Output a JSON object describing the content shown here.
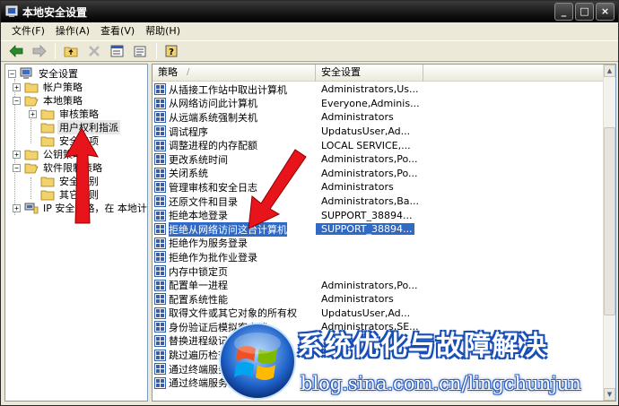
{
  "window": {
    "title": "本地安全设置",
    "buttons": [
      "_",
      "□",
      "×"
    ]
  },
  "menu": [
    "文件(F)",
    "操作(A)",
    "查看(V)",
    "帮助(H)"
  ],
  "toolbar": {
    "icons": [
      "back-icon",
      "forward-icon",
      "up-folder-icon",
      "delete-icon",
      "properties-icon",
      "export-list-icon",
      "help-icon"
    ]
  },
  "tree": [
    {
      "label": "安全设置",
      "level": 0,
      "expander": "−",
      "icon": "security-settings-icon"
    },
    {
      "label": "帐户策略",
      "level": 1,
      "expander": "+",
      "icon": "folder-icon"
    },
    {
      "label": "本地策略",
      "level": 1,
      "expander": "−",
      "icon": "folder-open-icon"
    },
    {
      "label": "审核策略",
      "level": 2,
      "expander": "+",
      "icon": "folder-icon"
    },
    {
      "label": "用户权利指派",
      "level": 2,
      "expander": "",
      "icon": "folder-icon",
      "selected": true
    },
    {
      "label": "安全选项",
      "level": 2,
      "expander": "",
      "icon": "folder-icon"
    },
    {
      "label": "公钥策略",
      "level": 1,
      "expander": "+",
      "icon": "folder-icon"
    },
    {
      "label": "软件限制策略",
      "level": 1,
      "expander": "−",
      "icon": "folder-open-icon"
    },
    {
      "label": "安全级别",
      "level": 2,
      "expander": "",
      "icon": "folder-icon"
    },
    {
      "label": "其它规则",
      "level": 2,
      "expander": "",
      "icon": "folder-icon"
    },
    {
      "label": "IP 安全策略，在 本地计",
      "level": 1,
      "expander": "+",
      "icon": "ip-security-icon"
    }
  ],
  "list": {
    "columns": [
      "策略",
      "安全设置"
    ],
    "sort_glyph": "/",
    "rows": [
      {
        "name": "从插接工作站中取出计算机",
        "setting": "Administrators,Us..."
      },
      {
        "name": "从网络访问此计算机",
        "setting": "Everyone,Adminis..."
      },
      {
        "name": "从远端系统强制关机",
        "setting": "Administrators"
      },
      {
        "name": "调试程序",
        "setting": "UpdatusUser,Ad..."
      },
      {
        "name": "调整进程的内存配额",
        "setting": "LOCAL SERVICE,..."
      },
      {
        "name": "更改系统时间",
        "setting": "Administrators,Po..."
      },
      {
        "name": "关闭系统",
        "setting": "Administrators,Po..."
      },
      {
        "name": "管理审核和安全日志",
        "setting": "Administrators"
      },
      {
        "name": "还原文件和目录",
        "setting": "Administrators,Ba..."
      },
      {
        "name": "拒绝本地登录",
        "setting": "SUPPORT_38894..."
      },
      {
        "name": "拒绝从网络访问这台计算机",
        "setting": "SUPPORT_38894...",
        "selected": true
      },
      {
        "name": "拒绝作为服务登录",
        "setting": ""
      },
      {
        "name": "拒绝作为批作业登录",
        "setting": ""
      },
      {
        "name": "内存中锁定页",
        "setting": ""
      },
      {
        "name": "配置单一进程",
        "setting": "Administrators,Po..."
      },
      {
        "name": "配置系统性能",
        "setting": "Administrators"
      },
      {
        "name": "取得文件或其它对象的所有权",
        "setting": "UpdatusUser,Ad..."
      },
      {
        "name": "身份验证后模拟客户端",
        "setting": "Administrators,SE..."
      },
      {
        "name": "替换进程级记号",
        "setting": ""
      },
      {
        "name": "跳过遍历检查",
        "setting": ""
      },
      {
        "name": "通过终端服务允许登录",
        "setting": ""
      },
      {
        "name": "通过终端服务拒绝登录",
        "setting": ""
      }
    ]
  },
  "watermark": {
    "title": "系统优化与故障解决",
    "url": "blog.sina.com.cn/lingchunjun"
  },
  "colors": {
    "selection": "#316ac5",
    "annotation_arrow": "#e8141c",
    "watermark_blue": "#1a4fb5"
  }
}
